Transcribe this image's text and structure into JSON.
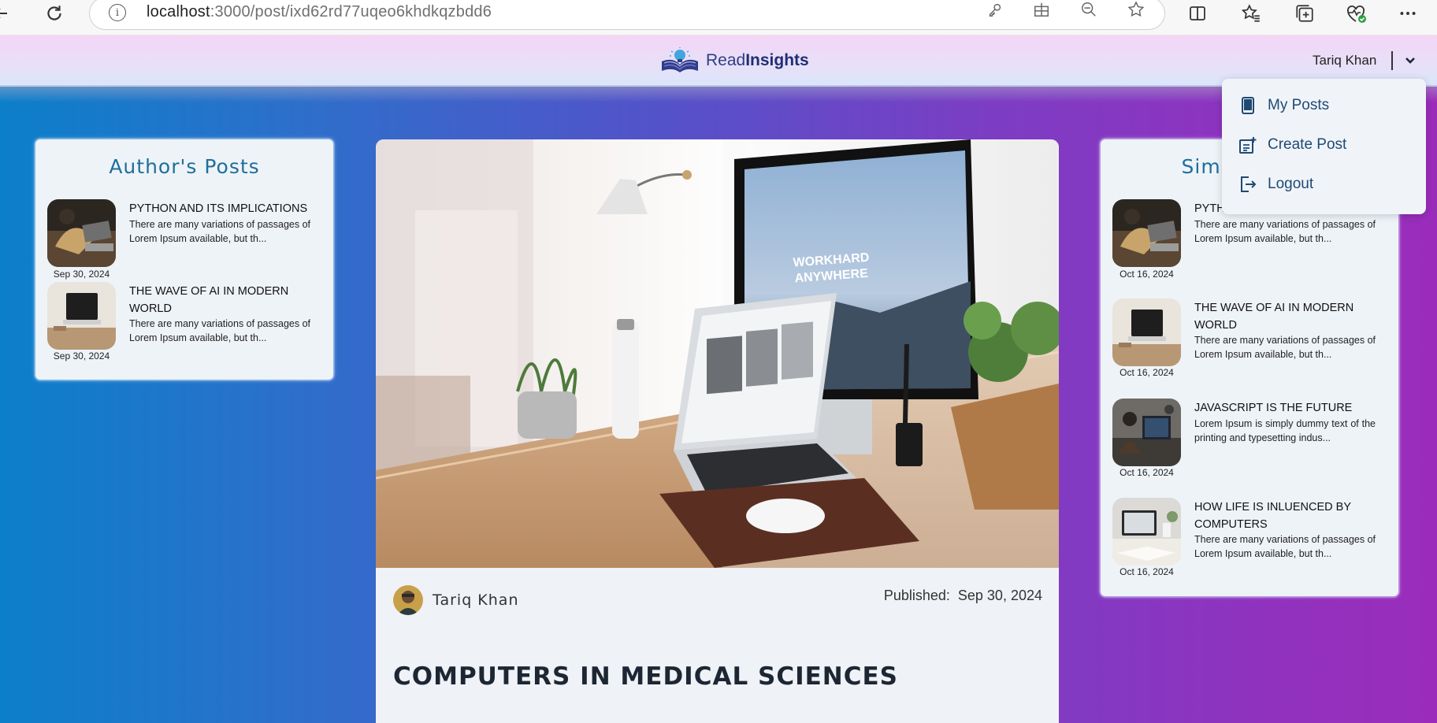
{
  "browser": {
    "url_host": "localhost",
    "url_path": ":3000/post/ixd62rd77uqeo6khdkqzbdd6",
    "icons": [
      "back-icon",
      "refresh-icon",
      "site-info-icon",
      "password-key-icon",
      "extensions-icon",
      "zoom-out-icon",
      "favorite-star-icon",
      "split-screen-icon",
      "favorites-icon",
      "collections-icon",
      "browser-health-icon",
      "more-icon"
    ]
  },
  "header": {
    "logo_part1": "Read",
    "logo_part2": "Insights",
    "user_name": "Tariq Khan"
  },
  "dropdown": {
    "items": [
      {
        "label": "My Posts",
        "icon": "book-icon"
      },
      {
        "label": "Create Post",
        "icon": "note-add-icon"
      },
      {
        "label": "Logout",
        "icon": "logout-icon"
      }
    ]
  },
  "author_posts": {
    "title": "Author's Posts",
    "items": [
      {
        "title": "PYTHON AND ITS IMPLICATIONS",
        "excerpt": "There are many variations of passages of Lorem Ipsum available, but th...",
        "date": "Sep 30, 2024"
      },
      {
        "title": "THE WAVE OF AI IN MODERN WORLD",
        "excerpt": "There are many variations of passages of Lorem Ipsum available, but th...",
        "date": "Sep 30, 2024"
      }
    ]
  },
  "similar_posts": {
    "title": "Similar Posts",
    "items": [
      {
        "title": "PYTHON AND ITS IMPLICATIONS",
        "excerpt": "There are many variations of passages of Lorem Ipsum available, but th...",
        "date": "Oct 16, 2024"
      },
      {
        "title": "THE WAVE OF AI IN MODERN WORLD",
        "excerpt": "There are many variations of passages of Lorem Ipsum available, but th...",
        "date": "Oct 16, 2024"
      },
      {
        "title": "JAVASCRIPT IS THE FUTURE",
        "excerpt": "Lorem Ipsum is simply dummy text of the printing and typesetting indus...",
        "date": "Oct 16, 2024"
      },
      {
        "title": "HOW LIFE IS INLUENCED BY COMPUTERS",
        "excerpt": "There are many variations of passages of Lorem Ipsum available, but th...",
        "date": "Oct 16, 2024"
      }
    ]
  },
  "post": {
    "author": "Tariq Khan",
    "published_label": "Published:",
    "published_date": "Sep 30, 2024",
    "title": "COMPUTERS IN MEDICAL SCIENCES",
    "hero_text_1": "WORKHARD",
    "hero_text_2": "ANYWHERE"
  }
}
